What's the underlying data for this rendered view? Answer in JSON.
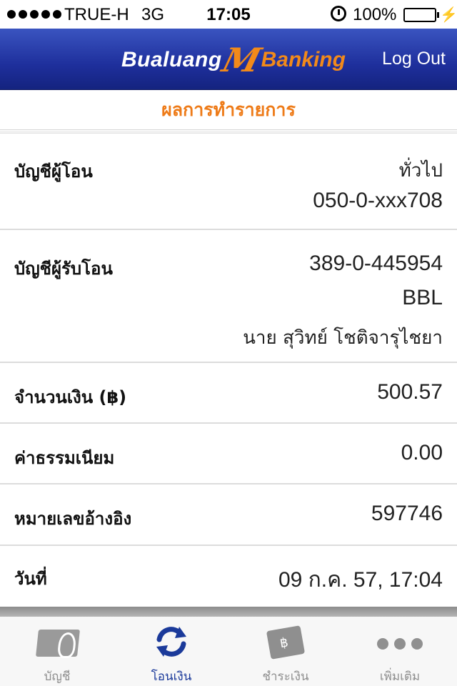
{
  "status_bar": {
    "carrier": "TRUE-H",
    "network": "3G",
    "time": "17:05",
    "battery": "100%"
  },
  "nav": {
    "logo_left": "Bualuang",
    "logo_mark": "M",
    "logo_right": "Banking",
    "logout": "Log Out"
  },
  "page": {
    "title": "ผลการทำรายการ"
  },
  "rows": {
    "from_account": {
      "label": "บัญชีผู้โอน",
      "type": "ทั่วไป",
      "number": "050-0-xxx708"
    },
    "to_account": {
      "label": "บัญชีผู้รับโอน",
      "number": "389-0-445954",
      "bank": "BBL",
      "name": "นาย สุวิทย์ โชติจารุไชยา"
    },
    "amount": {
      "label": "จำนวนเงิน (฿)",
      "value": "500.57"
    },
    "fee": {
      "label": "ค่าธรรมเนียม",
      "value": "0.00"
    },
    "reference": {
      "label": "หมายเลขอ้างอิง",
      "value": "597746"
    },
    "date": {
      "label": "วันที่",
      "value": "09 ก.ค. 57, 17:04"
    }
  },
  "tabbar": {
    "tabs": [
      {
        "label": "บัญชี",
        "icon": "account-card-icon"
      },
      {
        "label": "โอนเงิน",
        "icon": "transfer-icon"
      },
      {
        "label": "ชำระเงิน",
        "icon": "payment-wallet-icon"
      },
      {
        "label": "เพิ่มเติม",
        "icon": "more-icon"
      }
    ],
    "active_color": "#1b3a9a"
  },
  "colors": {
    "nav_blue": "#1e2f9c",
    "accent_orange": "#ee7b18"
  }
}
